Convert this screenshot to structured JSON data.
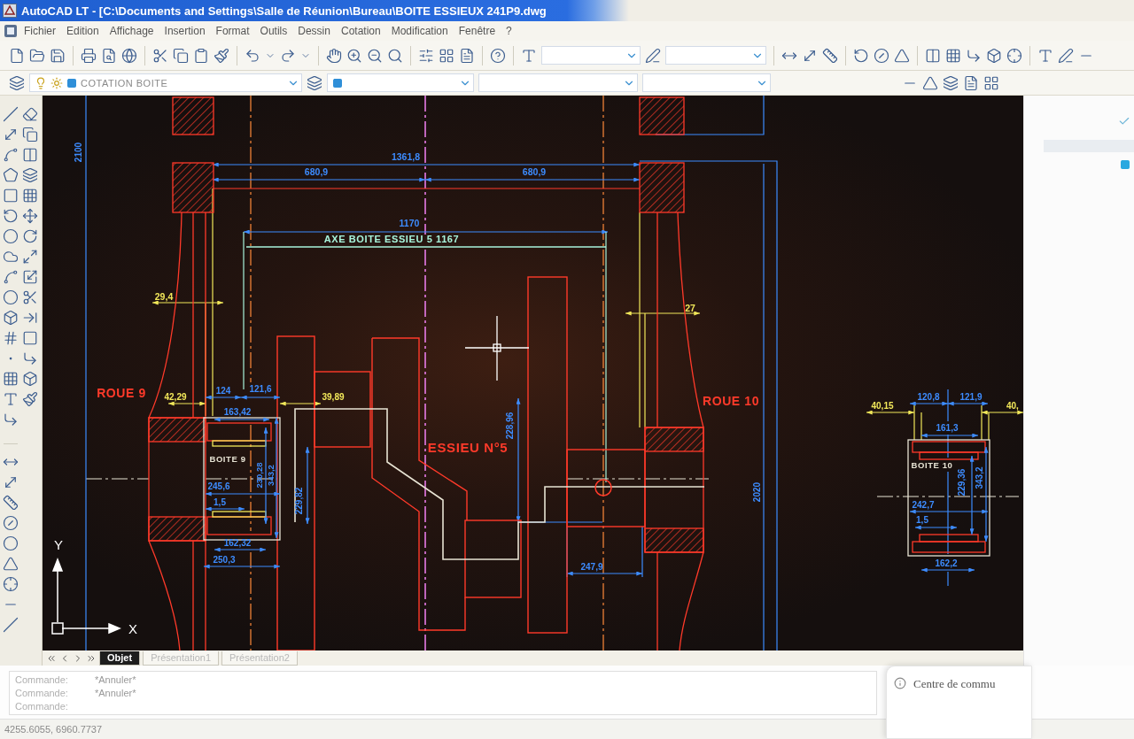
{
  "window": {
    "title": "AutoCAD LT - [C:\\Documents and Settings\\Salle de Réunion\\Bureau\\BOITE ESSIEUX 241P9.dwg"
  },
  "menu": [
    "Fichier",
    "Edition",
    "Affichage",
    "Insertion",
    "Format",
    "Outils",
    "Dessin",
    "Cotation",
    "Modification",
    "Fenêtre",
    "?"
  ],
  "layer_toolbar": {
    "layer": "COTATION BOITE"
  },
  "drawing": {
    "labels": [
      {
        "text": "2100",
        "kind": "dimension",
        "color": "#3d8cff"
      },
      {
        "text": "1361,8",
        "kind": "dimension",
        "color": "#3d8cff"
      },
      {
        "text": "680,9",
        "kind": "dimension",
        "color": "#3d8cff"
      },
      {
        "text": "680,9",
        "kind": "dimension",
        "color": "#3d8cff"
      },
      {
        "text": "1170",
        "kind": "dimension",
        "color": "#3d8cff"
      },
      {
        "text": "AXE BOITE ESSIEU 5 1167",
        "kind": "label",
        "color": "#a8f5dc"
      },
      {
        "text": "29,4",
        "kind": "dimension",
        "color": "#f2e85a"
      },
      {
        "text": "27",
        "kind": "dimension",
        "color": "#f2e85a"
      },
      {
        "text": "120,8",
        "kind": "dimension",
        "color": "#3d8cff"
      },
      {
        "text": "121,9",
        "kind": "dimension",
        "color": "#3d8cff"
      },
      {
        "text": "124",
        "kind": "dimension",
        "color": "#3d8cff"
      },
      {
        "text": "121,6",
        "kind": "dimension",
        "color": "#3d8cff"
      },
      {
        "text": "ROUE 9",
        "kind": "label",
        "color": "#ff3a2a"
      },
      {
        "text": "42,29",
        "kind": "dimension",
        "color": "#f2e85a"
      },
      {
        "text": "39,89",
        "kind": "dimension",
        "color": "#f2e85a"
      },
      {
        "text": "ROUE 10",
        "kind": "label",
        "color": "#ff3a2a"
      },
      {
        "text": "40,15",
        "kind": "dimension",
        "color": "#f2e85a"
      },
      {
        "text": "40,",
        "kind": "dimension",
        "color": "#f2e85a"
      },
      {
        "text": "163,42",
        "kind": "dimension",
        "color": "#3d8cff"
      },
      {
        "text": "161,3",
        "kind": "dimension",
        "color": "#3d8cff"
      },
      {
        "text": "228,96",
        "kind": "dimension",
        "color": "#3d8cff"
      },
      {
        "text": "ESSIEU N°5",
        "kind": "label",
        "color": "#ff3a2a"
      },
      {
        "text": "BOITE 9",
        "kind": "label",
        "color": "#e8e4d4"
      },
      {
        "text": "230,28",
        "kind": "dimension",
        "color": "#3d8cff"
      },
      {
        "text": "343,2",
        "kind": "dimension",
        "color": "#3d8cff"
      },
      {
        "text": "BOITE 10",
        "kind": "label",
        "color": "#e8e4d4"
      },
      {
        "text": "229,36",
        "kind": "dimension",
        "color": "#3d8cff"
      },
      {
        "text": "343,2",
        "kind": "dimension",
        "color": "#3d8cff"
      },
      {
        "text": "245,6",
        "kind": "dimension",
        "color": "#3d8cff"
      },
      {
        "text": "1,5",
        "kind": "dimension",
        "color": "#3d8cff"
      },
      {
        "text": "229,82",
        "kind": "dimension",
        "color": "#3d8cff"
      },
      {
        "text": "2020",
        "kind": "dimension",
        "color": "#3d8cff"
      },
      {
        "text": "242,7",
        "kind": "dimension",
        "color": "#3d8cff"
      },
      {
        "text": "1,5",
        "kind": "dimension",
        "color": "#3d8cff"
      },
      {
        "text": "162,32",
        "kind": "dimension",
        "color": "#3d8cff"
      },
      {
        "text": "250,3",
        "kind": "dimension",
        "color": "#3d8cff"
      },
      {
        "text": "162,2",
        "kind": "dimension",
        "color": "#3d8cff"
      },
      {
        "text": "247,9",
        "kind": "dimension",
        "color": "#3d8cff"
      }
    ],
    "ucs_axes": [
      "Y",
      "X"
    ]
  },
  "layout_tabs": [
    {
      "label": "Objet",
      "selected": true
    },
    {
      "label": "Présentation1",
      "selected": false
    },
    {
      "label": "Présentation2",
      "selected": false
    }
  ],
  "command_history": [
    {
      "prompt": "Commande:",
      "message": "*Annuler*"
    },
    {
      "prompt": "Commande:",
      "message": "*Annuler*"
    },
    {
      "prompt": "Commande:"
    }
  ],
  "status_bar": {
    "coordinates": "4255.6055, 6960.7737"
  },
  "notification": {
    "text": "Centre de commu"
  }
}
